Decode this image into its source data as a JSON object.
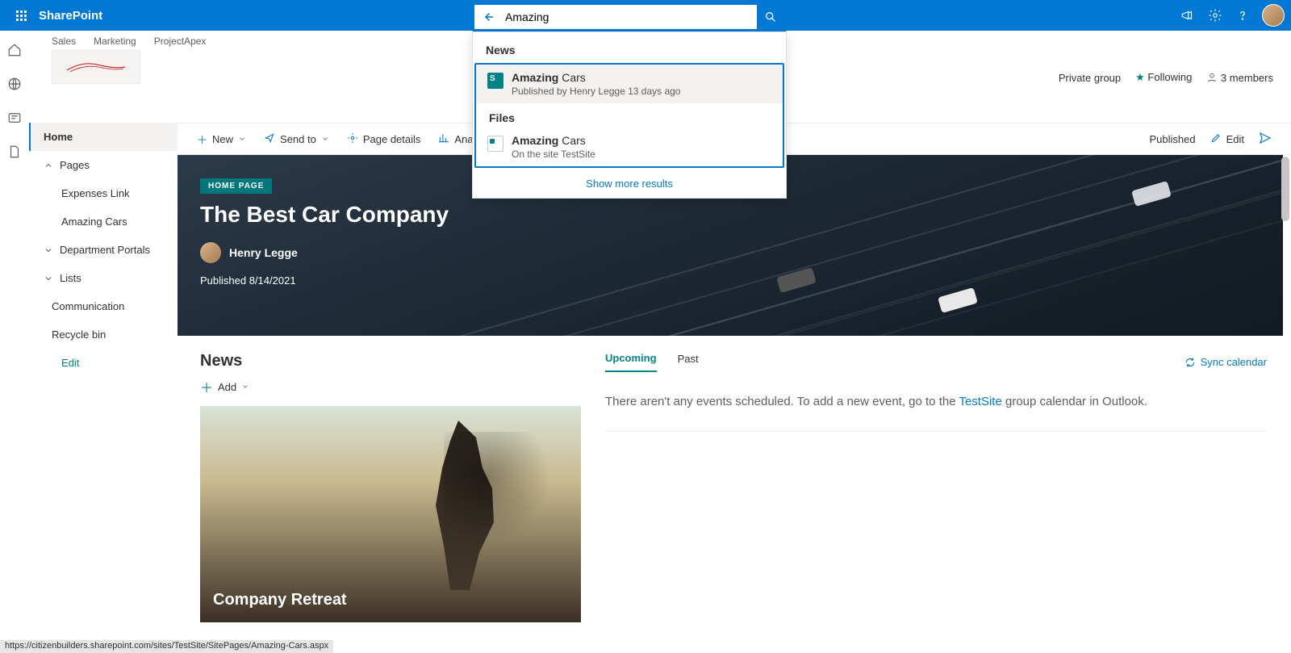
{
  "suite": {
    "app": "SharePoint"
  },
  "search": {
    "value": "Amazing",
    "news_header": "News",
    "files_header": "Files",
    "more": "Show more results",
    "news_item": {
      "bold": "Amazing",
      "rest": " Cars",
      "sub": "Published by Henry Legge 13 days ago"
    },
    "file_item": {
      "bold": "Amazing",
      "rest": " Cars",
      "sub": "On the site TestSite"
    }
  },
  "hub": {
    "links": [
      "Sales",
      "Marketing",
      "ProjectApex"
    ]
  },
  "siteInfo": {
    "privacy": "Private group",
    "following": "Following",
    "members": "3 members"
  },
  "cmd": {
    "new": "New",
    "sendto": "Send to",
    "pagedetails": "Page details",
    "analytics": "Analytics",
    "published": "Published",
    "edit": "Edit"
  },
  "nav": {
    "home": "Home",
    "pages": "Pages",
    "expenses": "Expenses Link",
    "amazing": "Amazing Cars",
    "dept": "Department Portals",
    "lists": "Lists",
    "comm": "Communication",
    "recycle": "Recycle bin",
    "edit": "Edit"
  },
  "hero": {
    "badge": "HOME PAGE",
    "title": "The Best Car Company",
    "author": "Henry Legge",
    "published": "Published 8/14/2021"
  },
  "news": {
    "title": "News",
    "add": "Add",
    "card_title": "Company Retreat"
  },
  "events": {
    "upcoming": "Upcoming",
    "past": "Past",
    "sync": "Sync calendar",
    "empty_pre": "There aren't any events scheduled. To add a new event, go to the ",
    "empty_link": "TestSite",
    "empty_post": " group calendar in Outlook."
  },
  "status": "https://citizenbuilders.sharepoint.com/sites/TestSite/SitePages/Amazing-Cars.aspx"
}
